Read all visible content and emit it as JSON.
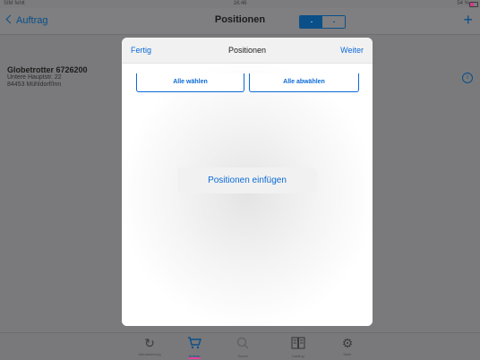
{
  "statusbar": {
    "carrier": "SIM fehlt",
    "time": "16:46",
    "battery": "54 %"
  },
  "navbar": {
    "back_label": "Auftrag",
    "title": "Positionen",
    "add_label": "+"
  },
  "customer": {
    "name": "Globetrotter 6726200",
    "street": "Untere Hauptstr. 22",
    "city": "84453 Mühldorf/Inn"
  },
  "modal": {
    "left_button": "Fertig",
    "title": "Positionen",
    "right_button": "Weiter",
    "select_all": "Alle wählen",
    "deselect_all": "Alle abwählen",
    "insert_button": "Positionen einfügen"
  },
  "tabbar": {
    "items": [
      {
        "label": "Aktualisierung",
        "icon": "refresh-icon"
      },
      {
        "label": "Auftrag",
        "icon": "cart-icon"
      },
      {
        "label": "Suche",
        "icon": "search-icon"
      },
      {
        "label": "Katalog",
        "icon": "catalog-icon"
      },
      {
        "label": "Mehr",
        "icon": "gears-icon"
      }
    ]
  },
  "colors": {
    "accent": "#0a6ad6",
    "nav_accent": "#0a4f88",
    "tab_marker": "#e0459a"
  }
}
